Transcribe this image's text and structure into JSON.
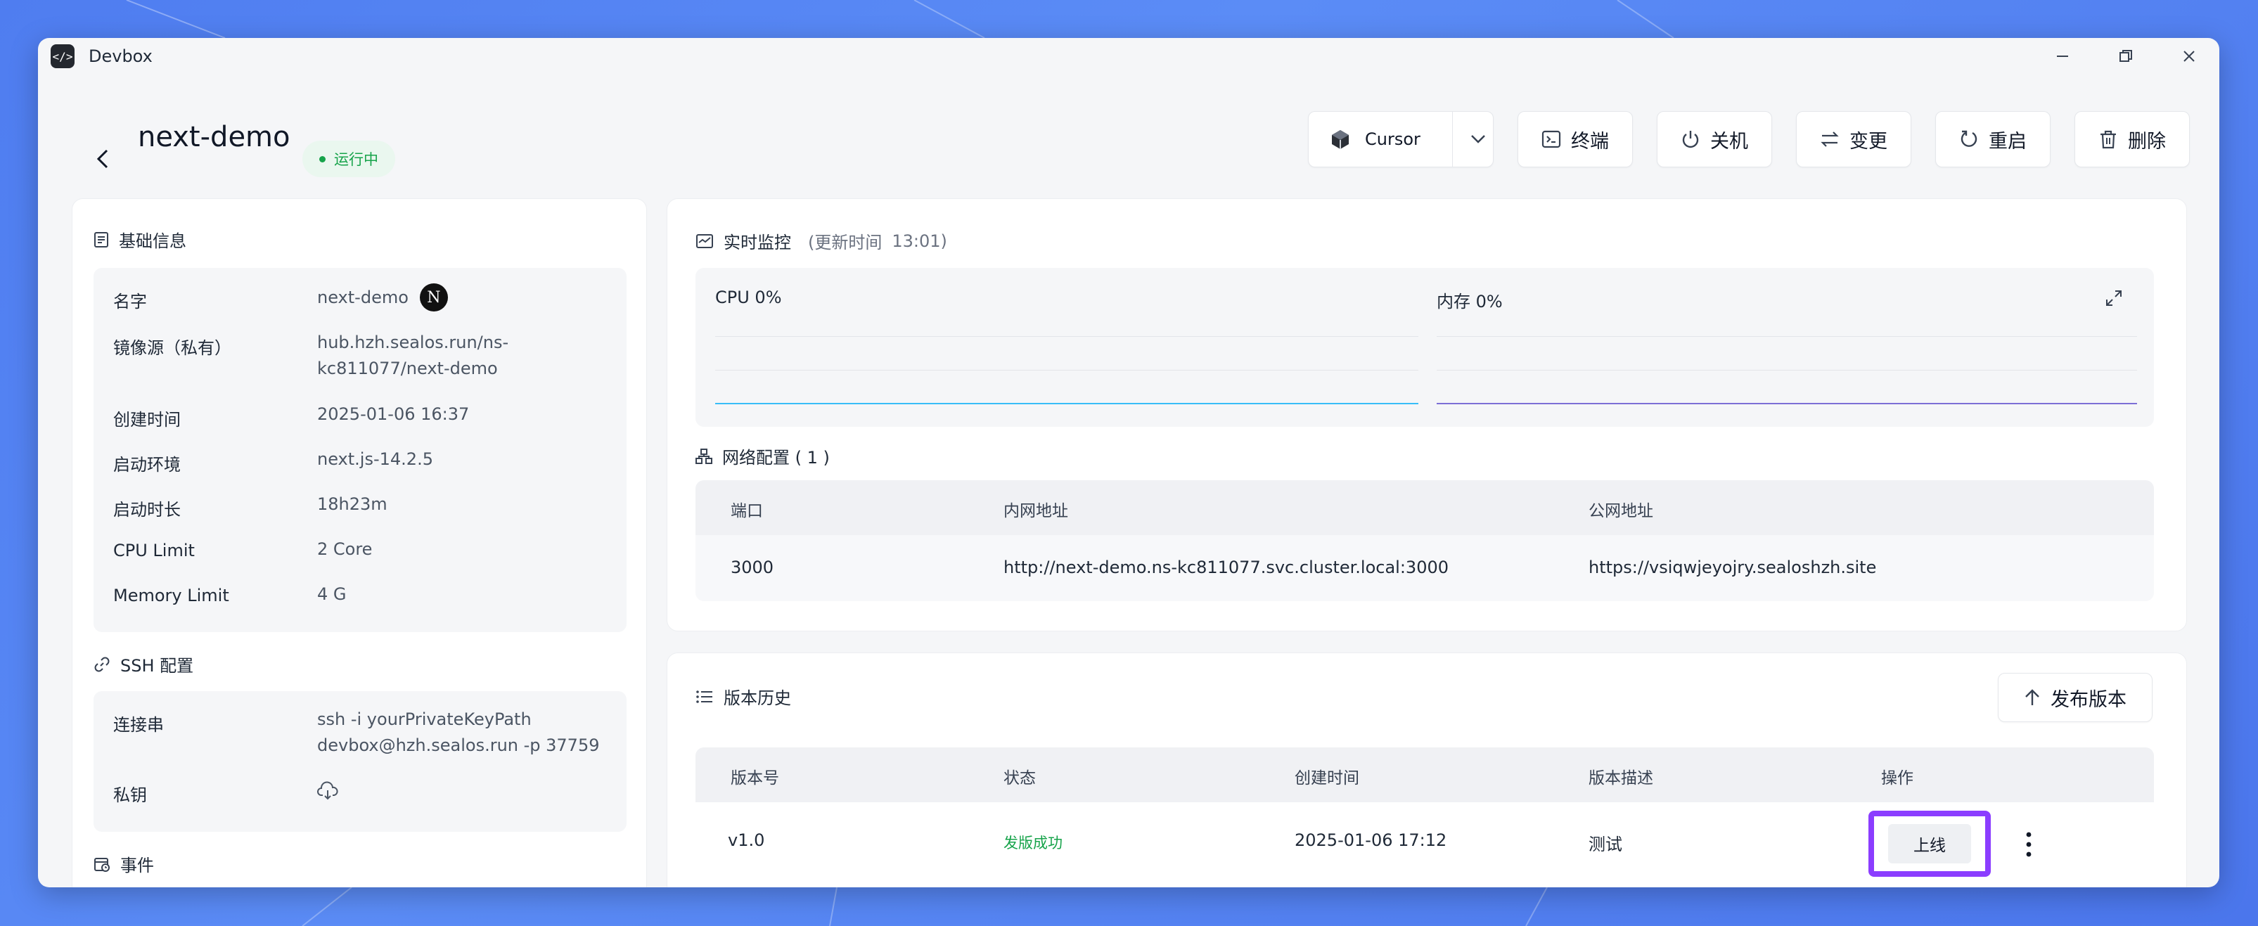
{
  "window": {
    "title": "Devbox",
    "logo_text": "</>"
  },
  "header": {
    "title": "next-demo",
    "status": "运行中"
  },
  "actions": {
    "ide_label": "Cursor",
    "terminal": "终端",
    "shutdown": "关机",
    "change": "变更",
    "restart": "重启",
    "delete": "删除"
  },
  "basic_info": {
    "title": "基础信息",
    "rows": [
      {
        "label": "名字",
        "value": "next-demo"
      },
      {
        "label": "镜像源（私有）",
        "value": "hub.hzh.sealos.run/ns-",
        "value2": "kc811077/next-demo"
      },
      {
        "label": "创建时间",
        "value": "2025-01-06 16:37"
      },
      {
        "label": "启动环境",
        "value": "next.js-14.2.5"
      },
      {
        "label": "启动时长",
        "value": "18h23m"
      },
      {
        "label": "CPU Limit",
        "value": "2 Core"
      },
      {
        "label": "Memory Limit",
        "value": "4 G"
      }
    ],
    "framework_icon_letter": "N"
  },
  "ssh": {
    "title": "SSH 配置",
    "conn_label": "连接串",
    "conn_value1": "ssh -i yourPrivateKeyPath",
    "conn_value2": "devbox@hzh.sealos.run -p 37759",
    "key_label": "私钥"
  },
  "events": {
    "title": "事件"
  },
  "monitor": {
    "title": "实时监控",
    "update_prefix": "(更新时间",
    "update_time": "13:01)",
    "cpu_label": "CPU 0%",
    "mem_label": "内存 0%",
    "cpu_color": "#38bdf8",
    "mem_color": "#7c6fd6"
  },
  "network": {
    "title": "网络配置 ( 1 )",
    "headers": [
      "端口",
      "内网地址",
      "公网地址"
    ],
    "rows": [
      {
        "port": "3000",
        "internal": "http://next-demo.ns-kc811077.svc.cluster.local:3000",
        "public": "https://vsiqwjeyojry.sealoshzh.site"
      }
    ]
  },
  "versions": {
    "title": "版本历史",
    "publish_button": "发布版本",
    "headers": [
      "版本号",
      "状态",
      "创建时间",
      "版本描述",
      "操作"
    ],
    "rows": [
      {
        "version": "v1.0",
        "status": "发版成功",
        "created": "2025-01-06 17:12",
        "desc": "测试",
        "action": "上线"
      }
    ],
    "status_color": "#16a34a",
    "highlight_color": "#8b3dff"
  }
}
